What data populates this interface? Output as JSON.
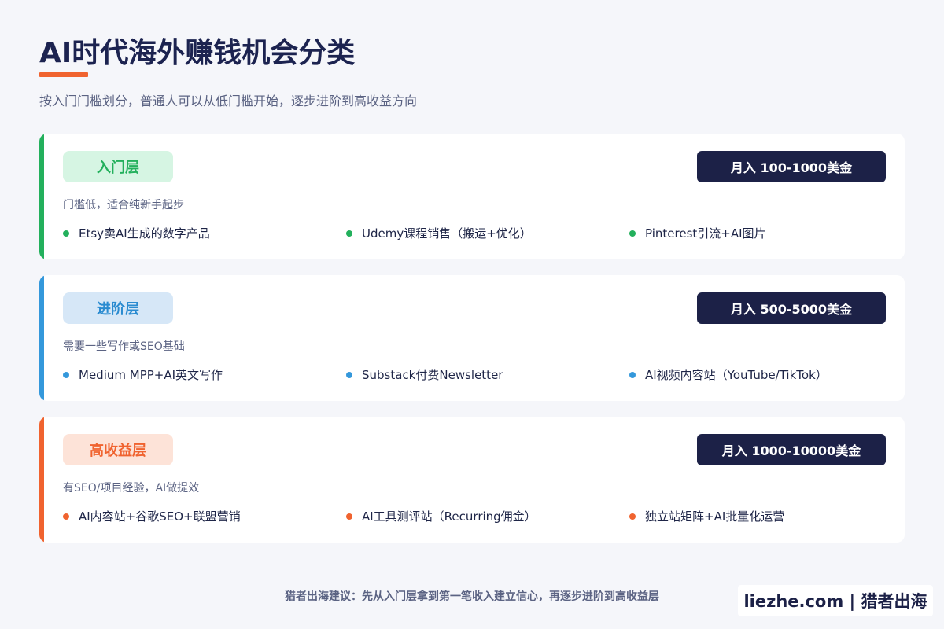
{
  "header": {
    "title": "AI时代海外赚钱机会分类",
    "subtitle": "按入门门槛划分，普通人可以从低门槛开始，逐步进阶到高收益方向",
    "accent_color": "#f0632f"
  },
  "tiers": [
    {
      "level": "入门层",
      "income": "月入 100-1000美金",
      "desc": "门槛低，适合纯新手起步",
      "accent": "#23b05c",
      "badge_bg": "#d6f5e3",
      "badge_text": "#23b05c",
      "items": [
        "Etsy卖AI生成的数字产品",
        "Udemy课程销售（搬运+优化）",
        "Pinterest引流+AI图片"
      ]
    },
    {
      "level": "进阶层",
      "income": "月入 500-5000美金",
      "desc": "需要一些写作或SEO基础",
      "accent": "#3498db",
      "badge_bg": "#d6e7f7",
      "badge_text": "#2a8bd0",
      "items": [
        "Medium MPP+AI英文写作",
        "Substack付费Newsletter",
        "AI视频内容站（YouTube/TikTok）"
      ]
    },
    {
      "level": "高收益层",
      "income": "月入 1000-10000美金",
      "desc": "有SEO/项目经验，AI做提效",
      "accent": "#f0632f",
      "badge_bg": "#fde3d8",
      "badge_text": "#f0632f",
      "items": [
        "AI内容站+谷歌SEO+联盟营销",
        "AI工具测评站（Recurring佣金）",
        "独立站矩阵+AI批量化运营"
      ]
    }
  ],
  "footer": {
    "note": "猎者出海建议：先从入门层拿到第一笔收入建立信心，再逐步进阶到高收益层",
    "brand": "liezhe.com | 猎者出海"
  }
}
